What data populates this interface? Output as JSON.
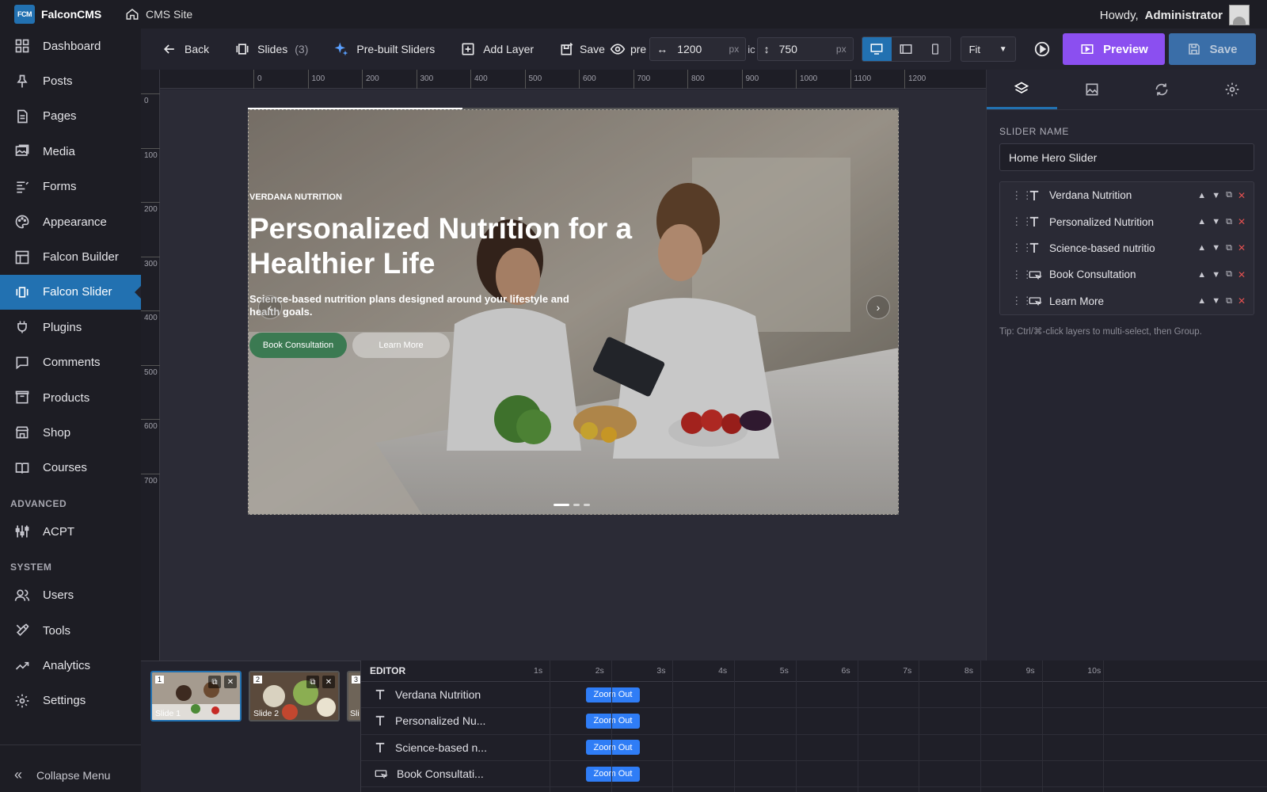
{
  "topbar": {
    "logo_text": "FCM",
    "brand": "FalconCMS",
    "site": "CMS Site",
    "howdy_prefix": "Howdy,",
    "user": "Administrator"
  },
  "sidebar": {
    "items": [
      {
        "label": "Dashboard",
        "icon": "dashboard-icon"
      },
      {
        "label": "Posts",
        "icon": "pin-icon"
      },
      {
        "label": "Pages",
        "icon": "page-icon"
      },
      {
        "label": "Media",
        "icon": "media-icon"
      },
      {
        "label": "Forms",
        "icon": "forms-icon"
      },
      {
        "label": "Appearance",
        "icon": "palette-icon"
      },
      {
        "label": "Falcon Builder",
        "icon": "builder-icon"
      },
      {
        "label": "Falcon Slider",
        "icon": "slider-icon",
        "active": true
      },
      {
        "label": "Plugins",
        "icon": "plugin-icon"
      },
      {
        "label": "Comments",
        "icon": "comment-icon"
      },
      {
        "label": "Products",
        "icon": "box-icon"
      },
      {
        "label": "Shop",
        "icon": "store-icon"
      },
      {
        "label": "Courses",
        "icon": "book-icon"
      }
    ],
    "advanced_heading": "ADVANCED",
    "advanced_items": [
      {
        "label": "ACPT",
        "icon": "sliders-icon"
      }
    ],
    "system_heading": "SYSTEM",
    "system_items": [
      {
        "label": "Users",
        "icon": "users-icon"
      },
      {
        "label": "Tools",
        "icon": "tools-icon"
      },
      {
        "label": "Analytics",
        "icon": "analytics-icon"
      },
      {
        "label": "Settings",
        "icon": "gear-icon"
      }
    ],
    "collapse_label": "Collapse Menu"
  },
  "toolbar": {
    "back": "Back",
    "slides": "Slides",
    "slides_count": "(3)",
    "prebuilt": "Pre-built Sliders",
    "add_layer": "Add Layer",
    "save_preset": "Save",
    "save_preset_overlap": "pre",
    "save_preset_tail": "ic",
    "width": "1200",
    "height": "750",
    "unit": "px",
    "fit": "Fit",
    "preview": "Preview",
    "save": "Save"
  },
  "ruler": {
    "top": [
      "0",
      "100",
      "200",
      "300",
      "400",
      "500",
      "600",
      "700",
      "800",
      "900",
      "1000",
      "1100",
      "1200"
    ],
    "left": [
      "0",
      "100",
      "200",
      "300",
      "400",
      "500",
      "600",
      "700"
    ]
  },
  "slide": {
    "kicker": "VERDANA NUTRITION",
    "headline": "Personalized Nutrition for a Healthier Life",
    "subtext": "Science-based nutrition plans designed around your lifestyle and health goals.",
    "cta_primary": "Book Consultation",
    "cta_secondary": "Learn More",
    "prev_arrow": "‹",
    "next_arrow": "›",
    "progress": 0.33,
    "active_dot": 1,
    "dot_count": 3
  },
  "right_panel": {
    "slider_name_label": "SLIDER NAME",
    "slider_name_value": "Home Hero Slider",
    "layers": [
      {
        "name": "Verdana Nutrition",
        "type": "text"
      },
      {
        "name": "Personalized Nutrition",
        "type": "text"
      },
      {
        "name": "Science-based nutritio",
        "type": "text"
      },
      {
        "name": "Book Consultation",
        "type": "button"
      },
      {
        "name": "Learn More",
        "type": "button"
      }
    ],
    "tip": "Tip: Ctrl/⌘-click layers to multi-select, then Group."
  },
  "thumbnails": [
    {
      "num": "1",
      "name": "Slide 1",
      "selected": true
    },
    {
      "num": "2",
      "name": "Slide 2"
    },
    {
      "num": "3",
      "name": "Sli"
    }
  ],
  "timeline": {
    "heading": "EDITOR",
    "seconds": [
      "1s",
      "2s",
      "3s",
      "4s",
      "5s",
      "6s",
      "7s",
      "8s",
      "9s",
      "10s"
    ],
    "rows": [
      {
        "name": "Verdana Nutrition",
        "type": "text",
        "effect": "Zoom Out"
      },
      {
        "name": "Personalized Nu...",
        "type": "text",
        "effect": "Zoom Out"
      },
      {
        "name": "Science-based n...",
        "type": "text",
        "effect": "Zoom Out"
      },
      {
        "name": "Book Consultati...",
        "type": "button",
        "effect": "Zoom Out"
      }
    ]
  },
  "colors": {
    "accent": "#2271b1",
    "preview": "#8b4ff0",
    "chip": "#2f7df6",
    "cta_primary": "#3b7a52"
  }
}
